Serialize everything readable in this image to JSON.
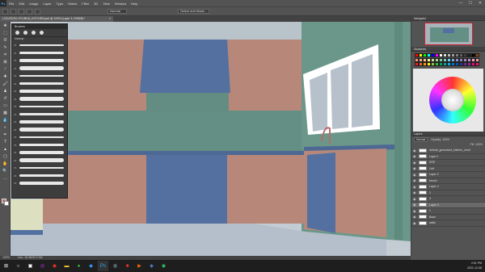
{
  "app": {
    "logo": "Ps"
  },
  "menu": [
    "File",
    "Edit",
    "Image",
    "Layer",
    "Type",
    "Select",
    "Filter",
    "3D",
    "View",
    "Window",
    "Help"
  ],
  "window_controls": [
    "—",
    "☐",
    "✕"
  ],
  "options": {
    "preset": "Normal",
    "search_field": "Select and Mask..."
  },
  "document_tab": {
    "title": "LOCATION: KYUNDA_KITCHEN.psd @ 100% (Layer 3, RGB/8) *",
    "close": "×"
  },
  "brushes": {
    "panel_title": "Brushes",
    "group_name": "Inkamp",
    "sizes": [
      "25",
      "25",
      "25",
      "25",
      "25",
      "25",
      "25",
      "25",
      "25",
      "25",
      "25",
      "25",
      "25",
      "25",
      "25",
      "25",
      "25",
      "25",
      "25"
    ]
  },
  "navigator": {
    "title": "Navigator"
  },
  "swatches": {
    "title": "Swatches",
    "colors": [
      "#ff0000",
      "#ffff00",
      "#00ff00",
      "#00ffff",
      "#0000ff",
      "#ff00ff",
      "#ffffff",
      "#e0e0e0",
      "#c0c0c0",
      "#a0a0a0",
      "#808080",
      "#606060",
      "#404040",
      "#202020",
      "#000000",
      "#8b4513",
      "#f7977a",
      "#f9ad81",
      "#fdc68a",
      "#fff79a",
      "#c4df9b",
      "#a2d39c",
      "#82ca9d",
      "#7bcdc8",
      "#6ecff6",
      "#7ea7d8",
      "#8493ca",
      "#8882be",
      "#a187be",
      "#bc8dbf",
      "#f49ac2",
      "#f6989d",
      "#ed1c24",
      "#f26522",
      "#f7941d",
      "#fff200",
      "#8dc73f",
      "#39b54a",
      "#00a651",
      "#00a99d",
      "#00aeef",
      "#0072bc",
      "#0054a6",
      "#2e3192",
      "#662d91",
      "#92278f",
      "#ec008c",
      "#ed145b"
    ]
  },
  "layers": {
    "title": "Layers",
    "blend_mode": "Normal",
    "opacity_label": "Opacity: 100%",
    "fill_label": "Fill: 100%",
    "items": [
      {
        "name": "default_generated_kitchen_ment"
      },
      {
        "name": "Layer 1"
      },
      {
        "name": "KRE"
      },
      {
        "name": "Cell"
      },
      {
        "name": "Layer 2"
      },
      {
        "name": "bench"
      },
      {
        "name": "Layer 4"
      },
      {
        "name": "2"
      },
      {
        "name": "3"
      },
      {
        "name": "Layer 3"
      },
      {
        "name": "1"
      },
      {
        "name": "Base"
      },
      {
        "name": "walls"
      }
    ]
  },
  "status": {
    "zoom": "100%",
    "doc": "Doc: 18.3M/572.9M"
  },
  "taskbar": {
    "time": "2:51 PM",
    "date": "2021-12-08"
  },
  "colors": {
    "wall": "#648f84",
    "cabinet": "#b7887a",
    "counter": "#5470a0",
    "floor": "#b4bfcb",
    "ceiling": "#c4ccd3",
    "window_frame": "#ffffff",
    "window_glass": "#b7c1cc"
  }
}
